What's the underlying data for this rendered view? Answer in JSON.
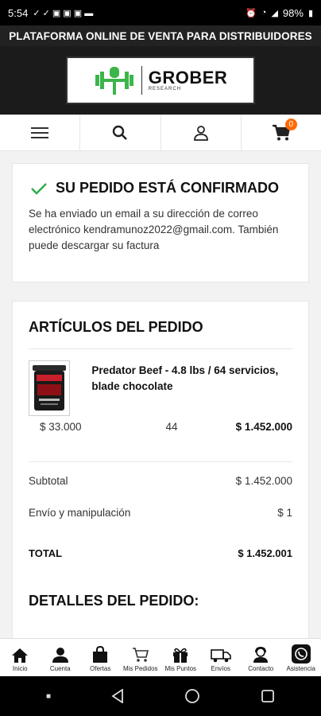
{
  "status_bar": {
    "time": "5:54",
    "battery": "98%"
  },
  "banner": {
    "text": "PLATAFORMA ONLINE DE VENTA PARA DISTRIBUIDORES"
  },
  "logo": {
    "name": "GROBER",
    "sub": "RESEARCH"
  },
  "nav": {
    "cart_count": "0"
  },
  "confirmation": {
    "title": "SU PEDIDO ESTÁ CONFIRMADO",
    "message": "Se ha enviado un email a su dirección de correo electrónico kendramunoz2022@gmail.com. También puede descargar su factura"
  },
  "order": {
    "items_title": "ARTÍCULOS DEL PEDIDO",
    "items": [
      {
        "name": "Predator Beef - 4.8 lbs / 64 servicios, blade chocolate",
        "unit_price": "$ 33.000",
        "quantity": "44",
        "total": "$ 1.452.000"
      }
    ],
    "subtotal_label": "Subtotal",
    "subtotal_value": "$ 1.452.000",
    "shipping_label": "Envío y manipulación",
    "shipping_value": "$ 1",
    "total_label": "TOTAL",
    "total_value": "$ 1.452.001",
    "details_title": "DETALLES DEL PEDIDO:"
  },
  "bottom_nav": [
    {
      "label": "Inicio"
    },
    {
      "label": "Cuenta"
    },
    {
      "label": "Ofertas"
    },
    {
      "label": "Mis Pedidos"
    },
    {
      "label": "Mis Puntos"
    },
    {
      "label": "Envíos"
    },
    {
      "label": "Contacto"
    },
    {
      "label": "Asistencia"
    }
  ],
  "colors": {
    "accent": "#ff6a00",
    "check": "#2eaa4a",
    "logo_green": "#3cb54a",
    "dark": "#1b1b1b"
  }
}
